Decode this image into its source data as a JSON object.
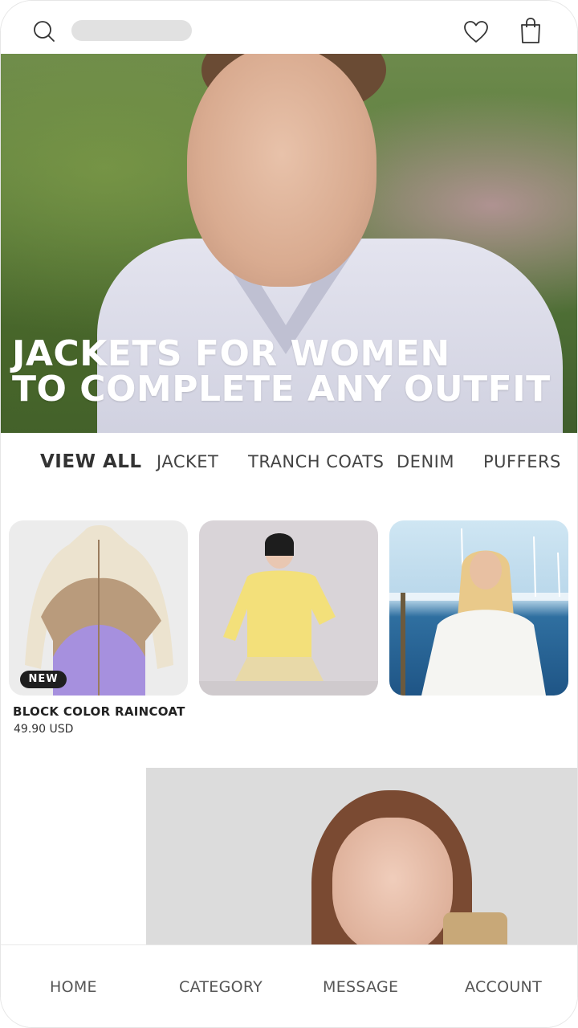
{
  "header": {
    "search_icon": "search-icon",
    "wishlist_icon": "heart-icon",
    "cart_icon": "shopping-bag-icon"
  },
  "hero": {
    "title_line1": "JACKETS FOR WOMEN",
    "title_line2": "TO COMPLETE ANY OUTFIT"
  },
  "tabs": [
    {
      "label": "VIEW ALL",
      "active": true
    },
    {
      "label": "JACKET",
      "active": false
    },
    {
      "label": "TRANCH COATS",
      "active": false
    },
    {
      "label": "DENIM",
      "active": false
    },
    {
      "label": "PUFFERS",
      "active": false
    }
  ],
  "products": [
    {
      "badge": "NEW",
      "name": "BLOCK COLOR RAINCOAT",
      "price": "49.90 USD"
    },
    {
      "badge": "",
      "name": "",
      "price": ""
    },
    {
      "badge": "",
      "name": "",
      "price": ""
    }
  ],
  "bottom_nav": [
    {
      "label": "HOME"
    },
    {
      "label": "CATEGORY"
    },
    {
      "label": "MESSAGE"
    },
    {
      "label": "ACCOUNT"
    }
  ],
  "colors": {
    "text_primary": "#333333",
    "badge_bg": "#1f1f1f",
    "search_placeholder_bg": "#e1e1e1"
  }
}
